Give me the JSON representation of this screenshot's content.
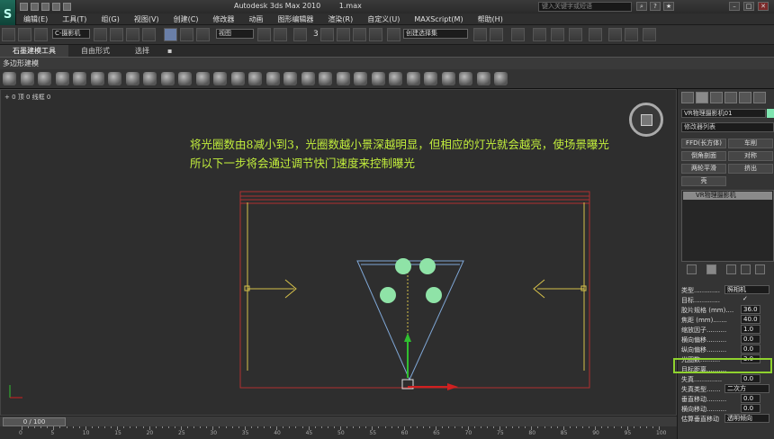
{
  "app": {
    "logo": "S",
    "title": "Autodesk 3ds Max 2010",
    "file": "1.max",
    "search_placeholder": "键入关键字或短语"
  },
  "menu": [
    "编辑(E)",
    "工具(T)",
    "组(G)",
    "视图(V)",
    "创建(C)",
    "修改器",
    "动画",
    "图形编辑器",
    "渲染(R)",
    "自定义(U)",
    "MAXScript(M)",
    "帮助(H)"
  ],
  "toolbar": {
    "selection_filter": "C-摄影机",
    "ref_coord": "视图",
    "named_selection": "创建选择集",
    "snap_label": "3"
  },
  "ribbon": {
    "tabs": [
      "石墨建模工具",
      "自由形式",
      "选择"
    ],
    "active_tab": "石墨建模工具",
    "subpanel": "多边形建模"
  },
  "viewport": {
    "label": "+ 0 顶 0 线框 0",
    "annotation_line1": "将光圈数由8减小到3，光圈数越小景深越明显，但相应的灯光就会越亮，使场景曝光",
    "annotation_line2": "所以下一步将会通过调节快门速度来控制曝光"
  },
  "panel": {
    "object_name": "VR物理摄影机01",
    "modifier_list": "修改器列表",
    "buttons": [
      "FFD(长方体)",
      "车削",
      "倒角剖面",
      "对称",
      "两轮平滑",
      "挤出",
      "壳"
    ],
    "stack_item": "VR物理摄影机",
    "params": [
      {
        "label": "类型.............",
        "value": "照相机"
      },
      {
        "label": "目标.............",
        "value": "✓"
      },
      {
        "label": "胶片规格 (mm)....",
        "value": "36.0"
      },
      {
        "label": "焦距 (mm).......",
        "value": "40.0"
      },
      {
        "label": "缩放因子..........",
        "value": "1.0"
      },
      {
        "label": "横向偏移..........",
        "value": "0.0"
      },
      {
        "label": "纵向偏移..........",
        "value": "0.0"
      },
      {
        "label": "光圈数..........",
        "value": "3.0"
      },
      {
        "label": "目标距离..........",
        "value": ""
      },
      {
        "label": "失真..............",
        "value": "0.0"
      },
      {
        "label": "失真类型.......",
        "value": "二次方"
      },
      {
        "label": "垂直移动..........",
        "value": "0.0"
      },
      {
        "label": "横向移动..........",
        "value": "0.0"
      },
      {
        "label": "估算垂直移动",
        "value": "透明倾向"
      }
    ]
  },
  "timeline": {
    "slider": "0 / 100",
    "ticks": [
      "0",
      "5",
      "10",
      "15",
      "20",
      "25",
      "30",
      "35",
      "40",
      "45",
      "50",
      "55",
      "60",
      "65",
      "70",
      "75",
      "80",
      "85",
      "90",
      "95",
      "100"
    ]
  }
}
